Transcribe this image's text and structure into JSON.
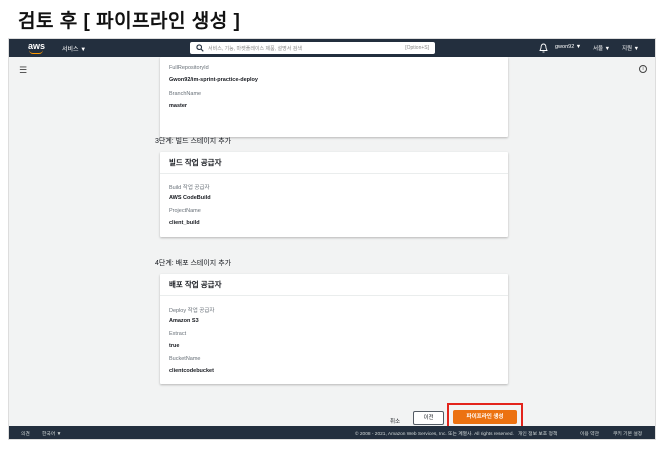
{
  "page_title": "검토 후 [ 파이프라인 생성 ]",
  "topnav": {
    "services": "서비스 ▼",
    "search_placeholder": "서비스, 기능, 마켓플레이스 제품, 설명서 검색",
    "search_shortcut": "[Option+S]",
    "user": "gwon92 ▼",
    "region": "서울 ▼",
    "support": "지원 ▼"
  },
  "source_card": {
    "fields": [
      {
        "label": "FullRepositoryId",
        "value": "Gwon92/im-sprint-practice-deploy"
      },
      {
        "label": "BranchName",
        "value": "master"
      }
    ]
  },
  "build_section": {
    "title": "3단계: 빌드 스테이지 추가",
    "card_header": "빌드 작업 공급자",
    "fields": [
      {
        "label": "Build 작업 공급자",
        "value": "AWS CodeBuild"
      },
      {
        "label": "ProjectName",
        "value": "client_build"
      }
    ]
  },
  "deploy_section": {
    "title": "4단계: 배포 스테이지 추가",
    "card_header": "배포 작업 공급자",
    "fields": [
      {
        "label": "Deploy 작업 공급자",
        "value": "Amazon S3"
      },
      {
        "label": "Extract",
        "value": "true"
      },
      {
        "label": "BucketName",
        "value": "clientcodebucket"
      }
    ]
  },
  "actions": {
    "cancel": "취소",
    "previous": "이전",
    "create": "파이프라인 생성"
  },
  "footer": {
    "feedback": "의견",
    "language": "한국어 ▼",
    "copyright": "© 2008 - 2021, Amazon Web Services, Inc. 또는 계열사. All rights reserved.",
    "privacy": "개인 정보 보호 정책",
    "terms": "이용 약관",
    "cookies": "쿠키 기본 설정"
  },
  "colors": {
    "nav_bg": "#232f3e",
    "primary_button": "#ec7211",
    "highlight_box": "#e3241b",
    "aws_orange": "#ff9900"
  }
}
